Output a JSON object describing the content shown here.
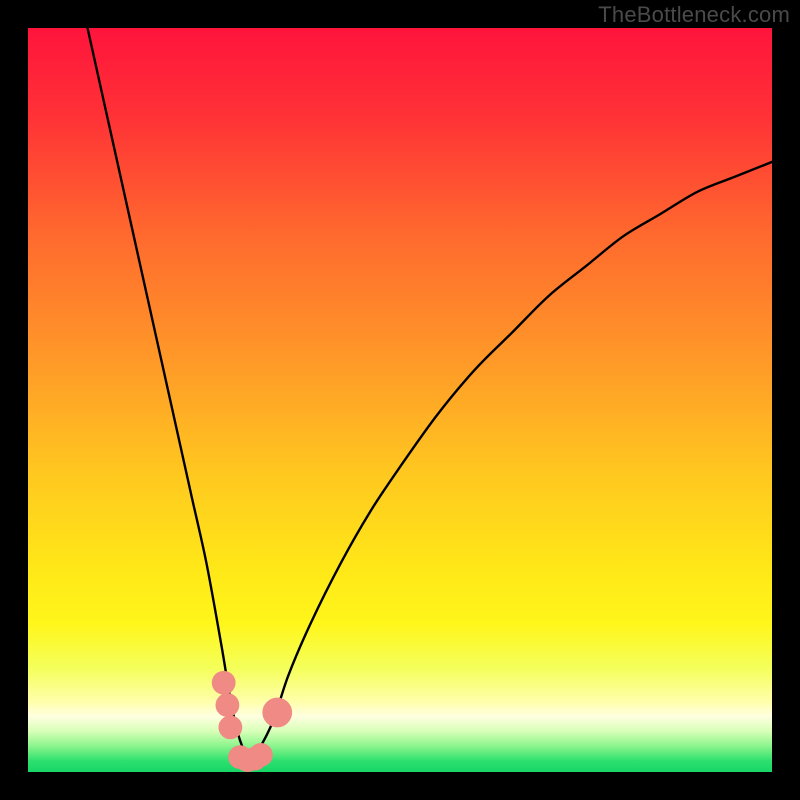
{
  "watermark": "TheBottleneck.com",
  "chart_data": {
    "type": "line",
    "title": "",
    "xlabel": "",
    "ylabel": "",
    "xlim": [
      0,
      100
    ],
    "ylim": [
      0,
      100
    ],
    "grid": false,
    "legend": false,
    "series": [
      {
        "name": "bottleneck-curve",
        "x": [
          8,
          10,
          12,
          14,
          16,
          18,
          20,
          22,
          24,
          26,
          27,
          28,
          29,
          30,
          31,
          33,
          35,
          38,
          42,
          46,
          50,
          55,
          60,
          65,
          70,
          75,
          80,
          85,
          90,
          95,
          100
        ],
        "y": [
          100,
          91,
          82,
          73,
          64,
          55,
          46,
          37,
          28,
          17,
          11,
          6,
          3,
          2,
          3,
          7,
          13,
          20,
          28,
          35,
          41,
          48,
          54,
          59,
          64,
          68,
          72,
          75,
          78,
          80,
          82
        ]
      }
    ],
    "markers": [
      {
        "name": "left-cluster",
        "x": 26.3,
        "y": 12,
        "r": 1.6
      },
      {
        "name": "left-cluster",
        "x": 26.8,
        "y": 9,
        "r": 1.6
      },
      {
        "name": "left-cluster",
        "x": 27.2,
        "y": 6,
        "r": 1.6
      },
      {
        "name": "valley-floor",
        "x": 28.5,
        "y": 2.0,
        "r": 1.6
      },
      {
        "name": "valley-floor",
        "x": 29.5,
        "y": 1.6,
        "r": 1.6
      },
      {
        "name": "valley-floor",
        "x": 30.5,
        "y": 1.8,
        "r": 1.6
      },
      {
        "name": "valley-floor",
        "x": 31.3,
        "y": 2.3,
        "r": 1.6
      },
      {
        "name": "right-dot",
        "x": 33.5,
        "y": 8,
        "r": 2.0
      }
    ],
    "marker_color": "#ef8a85",
    "curve_color": "#000000",
    "gradient_stops": [
      {
        "offset": 0.0,
        "color": "#ff143c"
      },
      {
        "offset": 0.12,
        "color": "#ff3236"
      },
      {
        "offset": 0.28,
        "color": "#ff6a2e"
      },
      {
        "offset": 0.45,
        "color": "#ff9a28"
      },
      {
        "offset": 0.6,
        "color": "#ffc81f"
      },
      {
        "offset": 0.72,
        "color": "#ffe618"
      },
      {
        "offset": 0.8,
        "color": "#fff61a"
      },
      {
        "offset": 0.86,
        "color": "#f4ff5a"
      },
      {
        "offset": 0.905,
        "color": "#ffffaa"
      },
      {
        "offset": 0.925,
        "color": "#ffffe0"
      },
      {
        "offset": 0.945,
        "color": "#d8ffb8"
      },
      {
        "offset": 0.965,
        "color": "#8cf58c"
      },
      {
        "offset": 0.985,
        "color": "#2ee06e"
      },
      {
        "offset": 1.0,
        "color": "#17d667"
      }
    ]
  }
}
